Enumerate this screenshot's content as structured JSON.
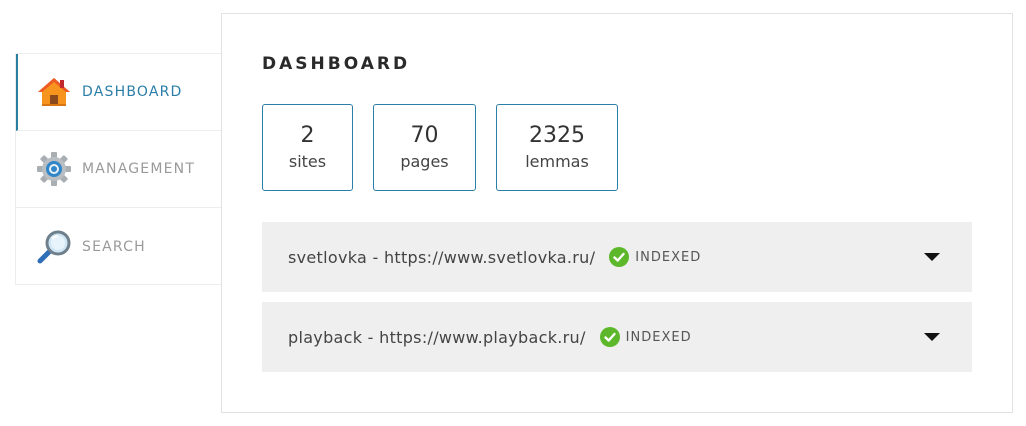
{
  "sidebar": {
    "items": [
      {
        "label": "DASHBOARD",
        "icon": "home-icon",
        "active": true
      },
      {
        "label": "MANAGEMENT",
        "icon": "gear-icon",
        "active": false
      },
      {
        "label": "SEARCH",
        "icon": "magnifier-icon",
        "active": false
      }
    ]
  },
  "main": {
    "title": "DASHBOARD",
    "stats": [
      {
        "value": "2",
        "label": "sites"
      },
      {
        "value": "70",
        "label": "pages"
      },
      {
        "value": "2325",
        "label": "lemmas"
      }
    ],
    "sites": [
      {
        "name": "svetlovka - https://www.svetlovka.ru/",
        "status": "INDEXED"
      },
      {
        "name": "playback - https://www.playback.ru/",
        "status": "INDEXED"
      }
    ]
  },
  "colors": {
    "accent": "#2b7ea8",
    "row_background": "#efefef",
    "status_ok": "#5cb82a"
  }
}
